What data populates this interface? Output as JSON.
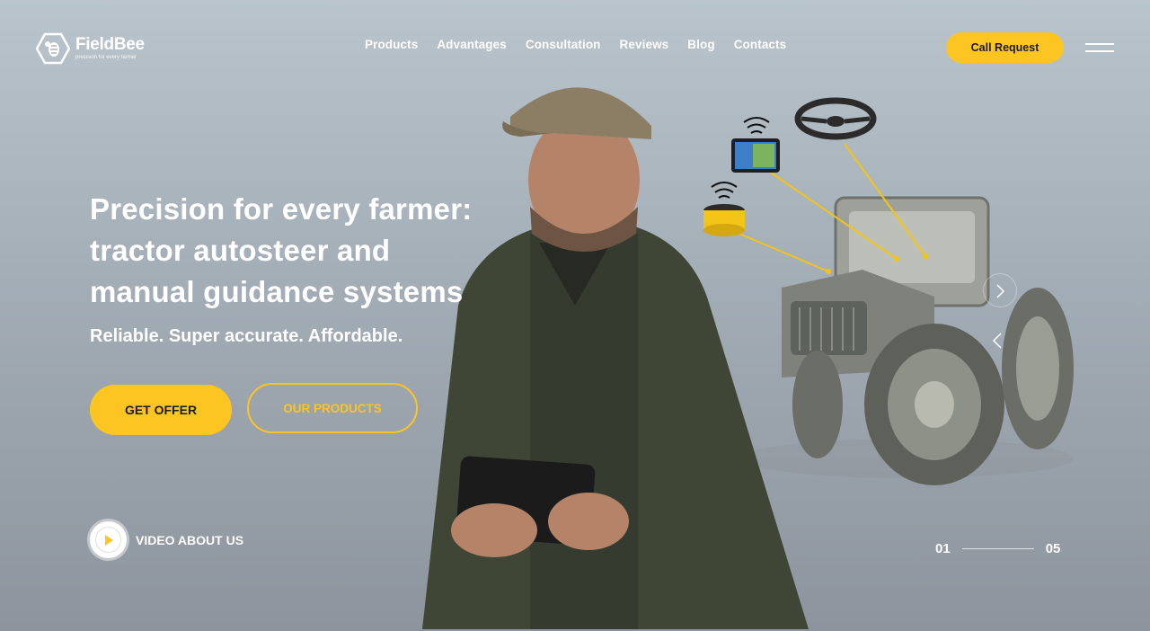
{
  "brand": {
    "name": "FieldBee",
    "tagline": "precision for every farmer"
  },
  "nav": {
    "items": [
      "Products",
      "Advantages",
      "Consultation",
      "Reviews",
      "Blog",
      "Contacts"
    ]
  },
  "header": {
    "call_label": "Call Request",
    "menu_icon": "hamburger-icon"
  },
  "hero": {
    "title": "Precision for every farmer: tractor autosteer and manual guidance systems",
    "subtitle": "Reliable. Super accurate. Affordable.",
    "offer_label": "GET OFFER",
    "products_label": "OUR PRODUCTS",
    "video_label": "VIDEO ABOUT US"
  },
  "slider": {
    "current": "01",
    "total": "05"
  },
  "colors": {
    "accent": "#fdc522",
    "dark": "#1d1d1d",
    "white": "#ffffff"
  }
}
